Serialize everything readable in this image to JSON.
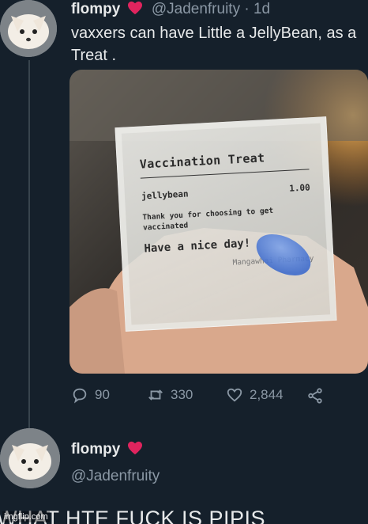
{
  "tweet": {
    "display_name": "flompy",
    "handle": "@Jadenfruity",
    "separator": "·",
    "time": "1d",
    "text": "vaxxers can have Little a JellyBean, as a Treat .",
    "stats": {
      "replies": "90",
      "retweets": "330",
      "likes": "2,844"
    }
  },
  "photo": {
    "packet_title": "Vaccination Treat",
    "item_name": "jellybean",
    "item_qty": "1.00",
    "thanks_text": "Thank you for choosing to get vaccinated",
    "closing_text": "Have a nice day!",
    "pharmacy": "Mangawhai Pharmacy"
  },
  "reply": {
    "display_name": "flompy",
    "handle": "@Jadenfruity",
    "text": "WHAT HTE FUCK IS PIPIS"
  },
  "watermark": "imgflip.com",
  "colors": {
    "background": "#15202b",
    "secondary_text": "#8b98a5",
    "heart": "#e0245e",
    "thread_line": "#38444d"
  },
  "icons": [
    "reply-icon",
    "retweet-icon",
    "like-icon",
    "share-icon",
    "heart-icon"
  ]
}
